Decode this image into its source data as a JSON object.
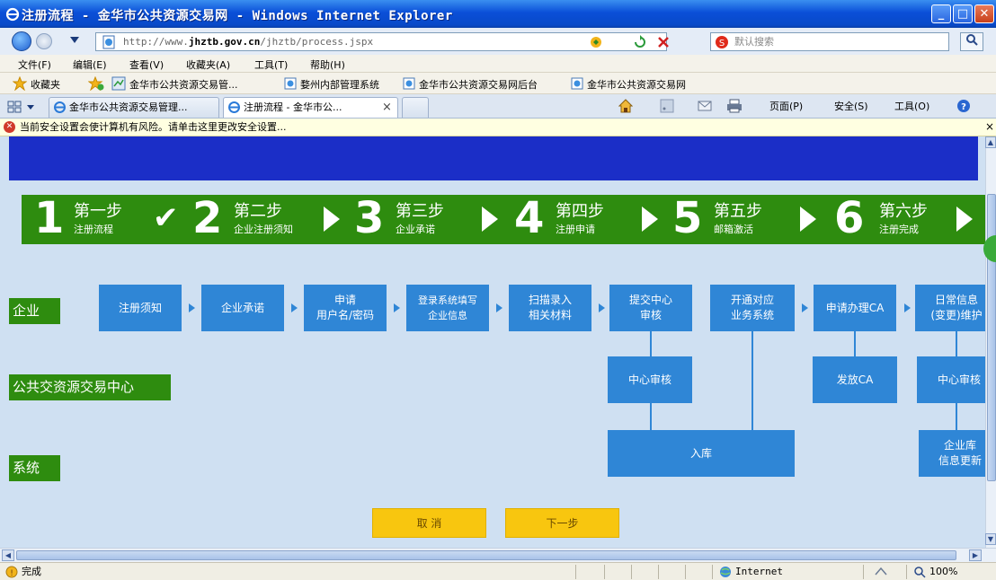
{
  "window": {
    "title": "注册流程 - 金华市公共资源交易网 - Windows Internet Explorer",
    "min_glyph": "_",
    "max_glyph": "□",
    "close_glyph": "✕"
  },
  "address_bar": {
    "url_prefix": "http://www.",
    "url_domain": "jhztb.gov.cn",
    "url_path": "/jhztb/process.jspx",
    "search_placeholder": "默认搜索"
  },
  "menu": [
    "文件(F)",
    "编辑(E)",
    "查看(V)",
    "收藏夹(A)",
    "工具(T)",
    "帮助(H)"
  ],
  "favorites": {
    "label": "收藏夹",
    "links": [
      "金华市公共资源交易管...",
      "婺州内部管理系统",
      "金华市公共资源交易网后台",
      "金华市公共资源交易网"
    ]
  },
  "tabs": [
    {
      "label": "金华市公共资源交易管理..."
    },
    {
      "label": "注册流程 - 金华市公...",
      "close": "×"
    }
  ],
  "command_bar": {
    "page": "页面(P)",
    "safety": "安全(S)",
    "tools": "工具(O)"
  },
  "info_bar": {
    "text": "当前安全设置会使计算机有风险。请单击这里更改安全设置...",
    "close": "×"
  },
  "steps": [
    {
      "num": "1",
      "title": "第一步",
      "sub": "注册流程"
    },
    {
      "num": "2",
      "title": "第二步",
      "sub": "企业注册须知"
    },
    {
      "num": "3",
      "title": "第三步",
      "sub": "企业承诺"
    },
    {
      "num": "4",
      "title": "第四步",
      "sub": "注册申请"
    },
    {
      "num": "5",
      "title": "第五步",
      "sub": "邮箱激活"
    },
    {
      "num": "6",
      "title": "第六步",
      "sub": "注册完成"
    }
  ],
  "roles": [
    "企业",
    "公共交资源交易中心",
    "系统"
  ],
  "flow": {
    "enterprise": [
      "注册须知",
      "企业承诺",
      "申请\n用户名/密码",
      "登录系统填写\n企业信息",
      "扫描录入\n相关材料",
      "提交中心\n审核",
      "开通对应\n业务系统",
      "申请办理CA",
      "日常信息\n(变更)维护"
    ],
    "center": [
      "中心审核",
      "发放CA",
      "中心审核"
    ],
    "system": [
      "入库",
      "企业库\n信息更新"
    ]
  },
  "buttons": {
    "cancel": "取 消",
    "next": "下一步"
  },
  "status_bar": {
    "status": "完成",
    "zone": "Internet",
    "zoom": "100%"
  }
}
